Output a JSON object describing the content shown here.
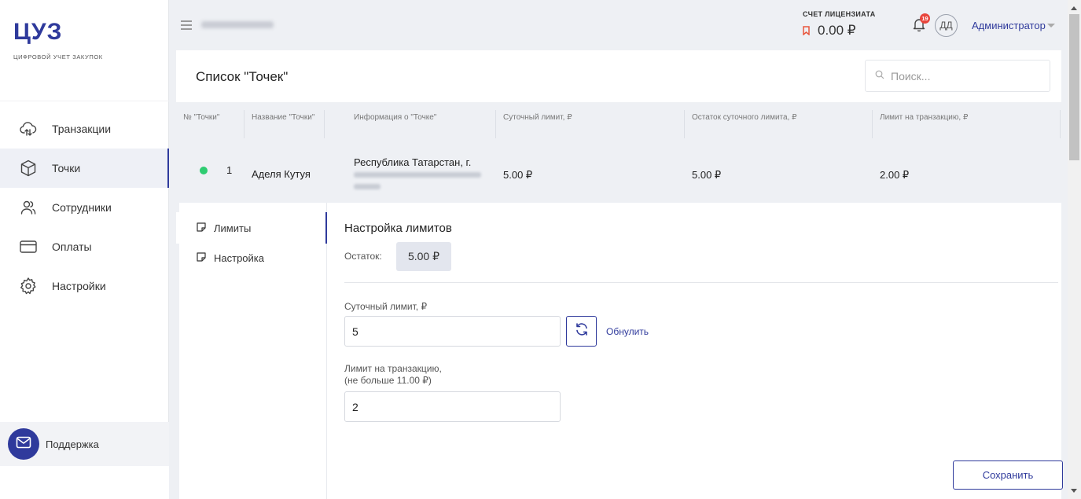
{
  "brand": {
    "logo": "ЦУЗ",
    "subtitle": "ЦИФРОВОЙ УЧЕТ ЗАКУПОК",
    "accent": "#2f3a9c"
  },
  "sidebar": {
    "items": [
      {
        "label": "Транзакции",
        "icon": "cloud-sync-icon",
        "active": false
      },
      {
        "label": "Точки",
        "icon": "cube-icon",
        "active": true
      },
      {
        "label": "Сотрудники",
        "icon": "users-icon",
        "active": false
      },
      {
        "label": "Оплаты",
        "icon": "card-icon",
        "active": false
      },
      {
        "label": "Настройки",
        "icon": "gear-icon",
        "active": false
      }
    ],
    "support_label": "Поддержка"
  },
  "topbar": {
    "license_title": "СЧЕТ ЛИЦЕНЗИАТА",
    "license_value": "0.00 ₽",
    "notifications_count": "19",
    "avatar_initials": "ДД",
    "user_name": "Администратор"
  },
  "page": {
    "title": "Список \"Точек\"",
    "search_placeholder": "Поиск..."
  },
  "table": {
    "headers": [
      "№ \"Точки\"",
      "Название \"Точки\"",
      "Информация о \"Точке\"",
      "Суточный лимит, ₽",
      "Остаток суточного лимита, ₽",
      "Лимит на транзакцию, ₽"
    ],
    "rows": [
      {
        "status": "active",
        "status_color": "#2ecc71",
        "number": "1",
        "name": "Аделя Кутуя",
        "info": "Республика Татарстан, г.",
        "daily_limit": "5.00 ₽",
        "daily_remaining": "5.00 ₽",
        "transaction_limit": "2.00 ₽"
      }
    ]
  },
  "panel": {
    "tabs": [
      {
        "label": "Лимиты",
        "active": true
      },
      {
        "label": "Настройка",
        "active": false
      }
    ],
    "title": "Настройка лимитов",
    "remain_label": "Остаток:",
    "remain_value": "5.00 ₽",
    "daily_limit_label": "Суточный лимит, ₽",
    "daily_limit_value": "5",
    "reset_label": "Обнулить",
    "transaction_label_line1": "Лимит на транзакцию,",
    "transaction_label_line2": "(не больше 11.00 ₽)",
    "transaction_value": "2",
    "save_label": "Сохранить"
  }
}
